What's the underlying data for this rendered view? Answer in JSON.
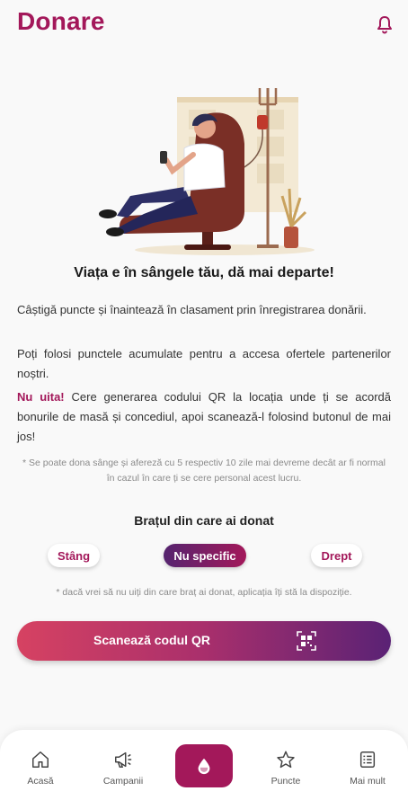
{
  "header": {
    "title": "Donare",
    "bell_icon": "bell-icon"
  },
  "colors": {
    "accent": "#a3185a",
    "gradient_start": "#d64262",
    "gradient_end": "#5a2275"
  },
  "hero": {
    "illustration": "person-donating-blood-in-chair"
  },
  "headline": "Viața e în sângele tău, dă mai departe!",
  "paragraphs": {
    "p1": "Câștigă puncte și înaintează în clasament prin înregistrarea donării.",
    "p2": "Poți folosi punctele acumulate pentru a accesa ofertele partenerilor noștri.",
    "p3_bold": "Nu uita!",
    "p3_rest": " Cere generarea codului QR la locația unde ți se acordă bonurile de masă și concediul, apoi scanează-l folosind butonul de mai jos!"
  },
  "note_1": "* Se poate dona sânge și afereză cu 5 respectiv 10 zile mai devreme decât ar fi normal în cazul în care ți se cere personal acest lucru.",
  "arm": {
    "title": "Brațul din care ai donat",
    "options": [
      "Stâng",
      "Nu specific",
      "Drept"
    ],
    "selected": "Nu specific"
  },
  "note_2": "* dacă vrei să nu uiți din care braț ai donat, aplicația îți stă la dispoziție.",
  "scan_button": {
    "label": "Scanează codul QR",
    "icon": "qr-code-icon"
  },
  "bottom_nav": {
    "items": [
      {
        "label": "Acasă",
        "icon": "home-icon"
      },
      {
        "label": "Campanii",
        "icon": "megaphone-icon"
      },
      {
        "label": "",
        "icon": "blood-drop-icon"
      },
      {
        "label": "Puncte",
        "icon": "star-icon"
      },
      {
        "label": "Mai mult",
        "icon": "list-icon"
      }
    ]
  }
}
